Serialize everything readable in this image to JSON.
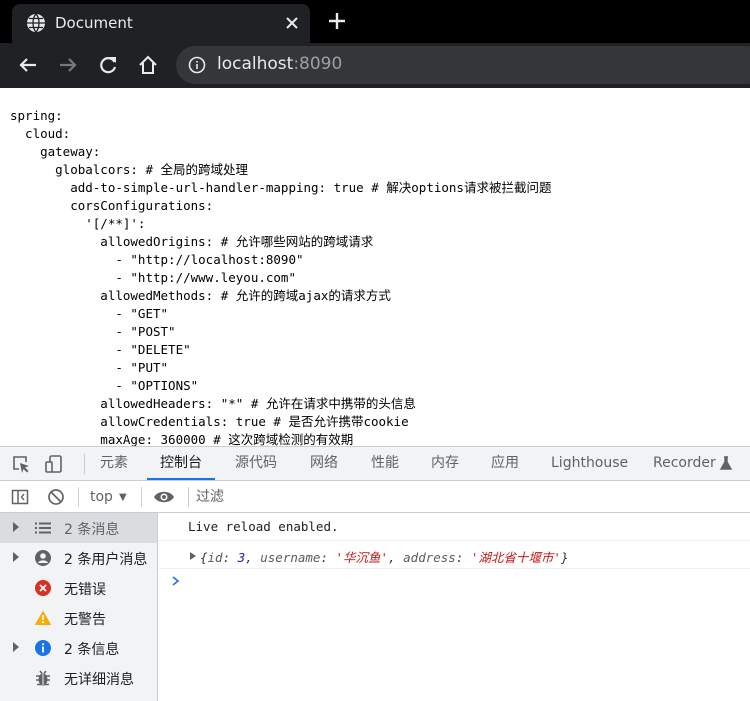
{
  "browser": {
    "tab_title": "Document",
    "url_host": "localhost",
    "url_port": ":8090"
  },
  "page": {
    "yaml_lines": [
      "spring:",
      "  cloud:",
      "    gateway:",
      "      globalcors: # 全局的跨域处理",
      "        add-to-simple-url-handler-mapping: true # 解决options请求被拦截问题",
      "        corsConfigurations:",
      "          '[/**]':",
      "            allowedOrigins: # 允许哪些网站的跨域请求",
      "              - \"http://localhost:8090\"",
      "              - \"http://www.leyou.com\"",
      "            allowedMethods: # 允许的跨域ajax的请求方式",
      "              - \"GET\"",
      "              - \"POST\"",
      "              - \"DELETE\"",
      "              - \"PUT\"",
      "              - \"OPTIONS\"",
      "            allowedHeaders: \"*\" # 允许在请求中携带的头信息",
      "            allowCredentials: true # 是否允许携带cookie",
      "            maxAge: 360000 # 这次跨域检测的有效期"
    ]
  },
  "devtools": {
    "tabs": [
      "元素",
      "控制台",
      "源代码",
      "网络",
      "性能",
      "内存",
      "应用",
      "Lighthouse",
      "Recorder"
    ],
    "active_tab": "控制台",
    "context": "top",
    "filter_placeholder": "过滤",
    "sidebar": [
      {
        "label": "2 条消息",
        "icon": "list-icon",
        "expandable": true,
        "selected": true
      },
      {
        "label": "2 条用户消息",
        "icon": "user-icon",
        "expandable": true,
        "selected": false
      },
      {
        "label": "无错误",
        "icon": "error-icon",
        "expandable": false,
        "selected": false
      },
      {
        "label": "无警告",
        "icon": "warning-icon",
        "expandable": false,
        "selected": false
      },
      {
        "label": "2 条信息",
        "icon": "info-icon",
        "expandable": true,
        "selected": false
      },
      {
        "label": "无详细消息",
        "icon": "bug-icon",
        "expandable": false,
        "selected": false
      }
    ],
    "console": {
      "message1": "Live reload enabled.",
      "object": {
        "open": "{",
        "id_key": "id",
        "id_value": "3",
        "username_key": "username",
        "username_value": "'华沉鱼'",
        "address_key": "address",
        "address_value": "'湖北省十堰市'",
        "close": "}"
      }
    }
  },
  "colors": {
    "accent": "#1a73e8",
    "error": "#d93025",
    "warning": "#f9ab00",
    "info": "#1a73e8",
    "string": "#c41a16",
    "number": "#1a1aa6"
  }
}
